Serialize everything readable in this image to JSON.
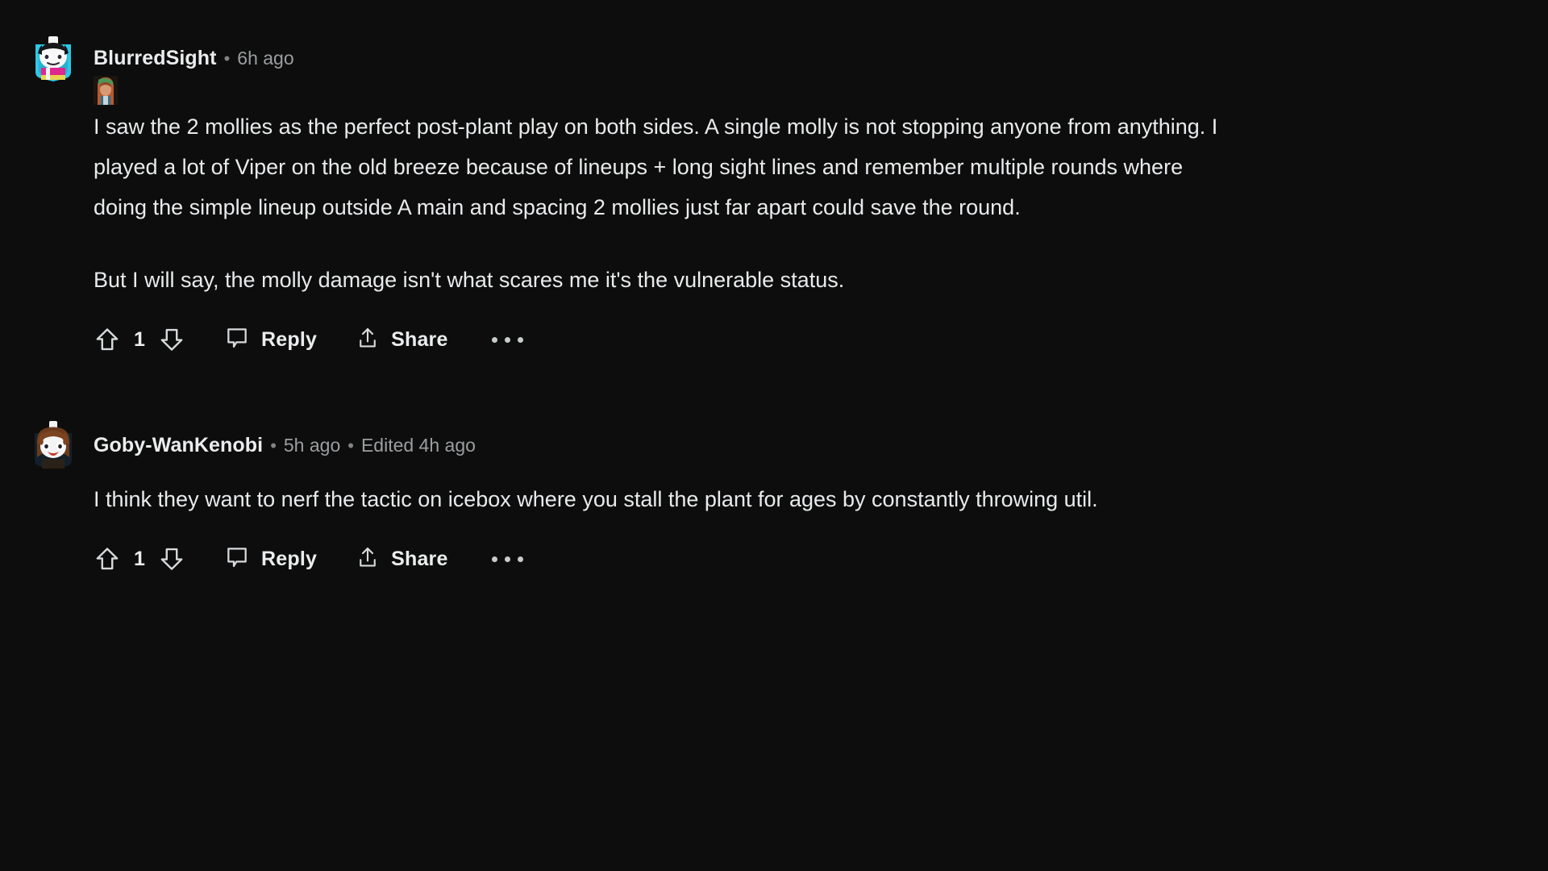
{
  "theme": {
    "background": "#0d0d0d",
    "text_color": "#e8eaec",
    "meta_color": "#9b9ea0"
  },
  "comments": [
    {
      "username": "BlurredSight",
      "separator": "•",
      "timestamp": "6h ago",
      "edited": null,
      "has_flair_image": true,
      "avatar": "snoo-avatar-blue",
      "paragraphs": [
        "I saw the 2 mollies as the perfect post-plant play on both sides. A single molly is not stopping anyone from anything. I played a lot of Viper on the old breeze because of lineups + long sight lines and remember multiple rounds where doing the simple lineup outside A main and spacing 2 mollies just far apart could save the round.",
        "But I will say, the molly damage isn't what scares me it's the vulnerable status."
      ],
      "score": "1",
      "upvote_icon": "arrow-up-icon",
      "downvote_icon": "arrow-down-icon",
      "reply_label": "Reply",
      "reply_icon": "comment-bubble-icon",
      "share_label": "Share",
      "share_icon": "share-arrow-icon",
      "overflow_icon": "more-options-icon"
    },
    {
      "username": "Goby-WanKenobi",
      "separator": "•",
      "timestamp": "5h ago",
      "edited": "Edited 4h ago",
      "has_flair_image": false,
      "avatar": "snoo-avatar-brown",
      "paragraphs": [
        "I think they want to nerf the tactic on icebox where you stall the plant for ages by constantly throwing util."
      ],
      "score": "1",
      "upvote_icon": "arrow-up-icon",
      "downvote_icon": "arrow-down-icon",
      "reply_label": "Reply",
      "reply_icon": "comment-bubble-icon",
      "share_label": "Share",
      "share_icon": "share-arrow-icon",
      "overflow_icon": "more-options-icon"
    }
  ]
}
